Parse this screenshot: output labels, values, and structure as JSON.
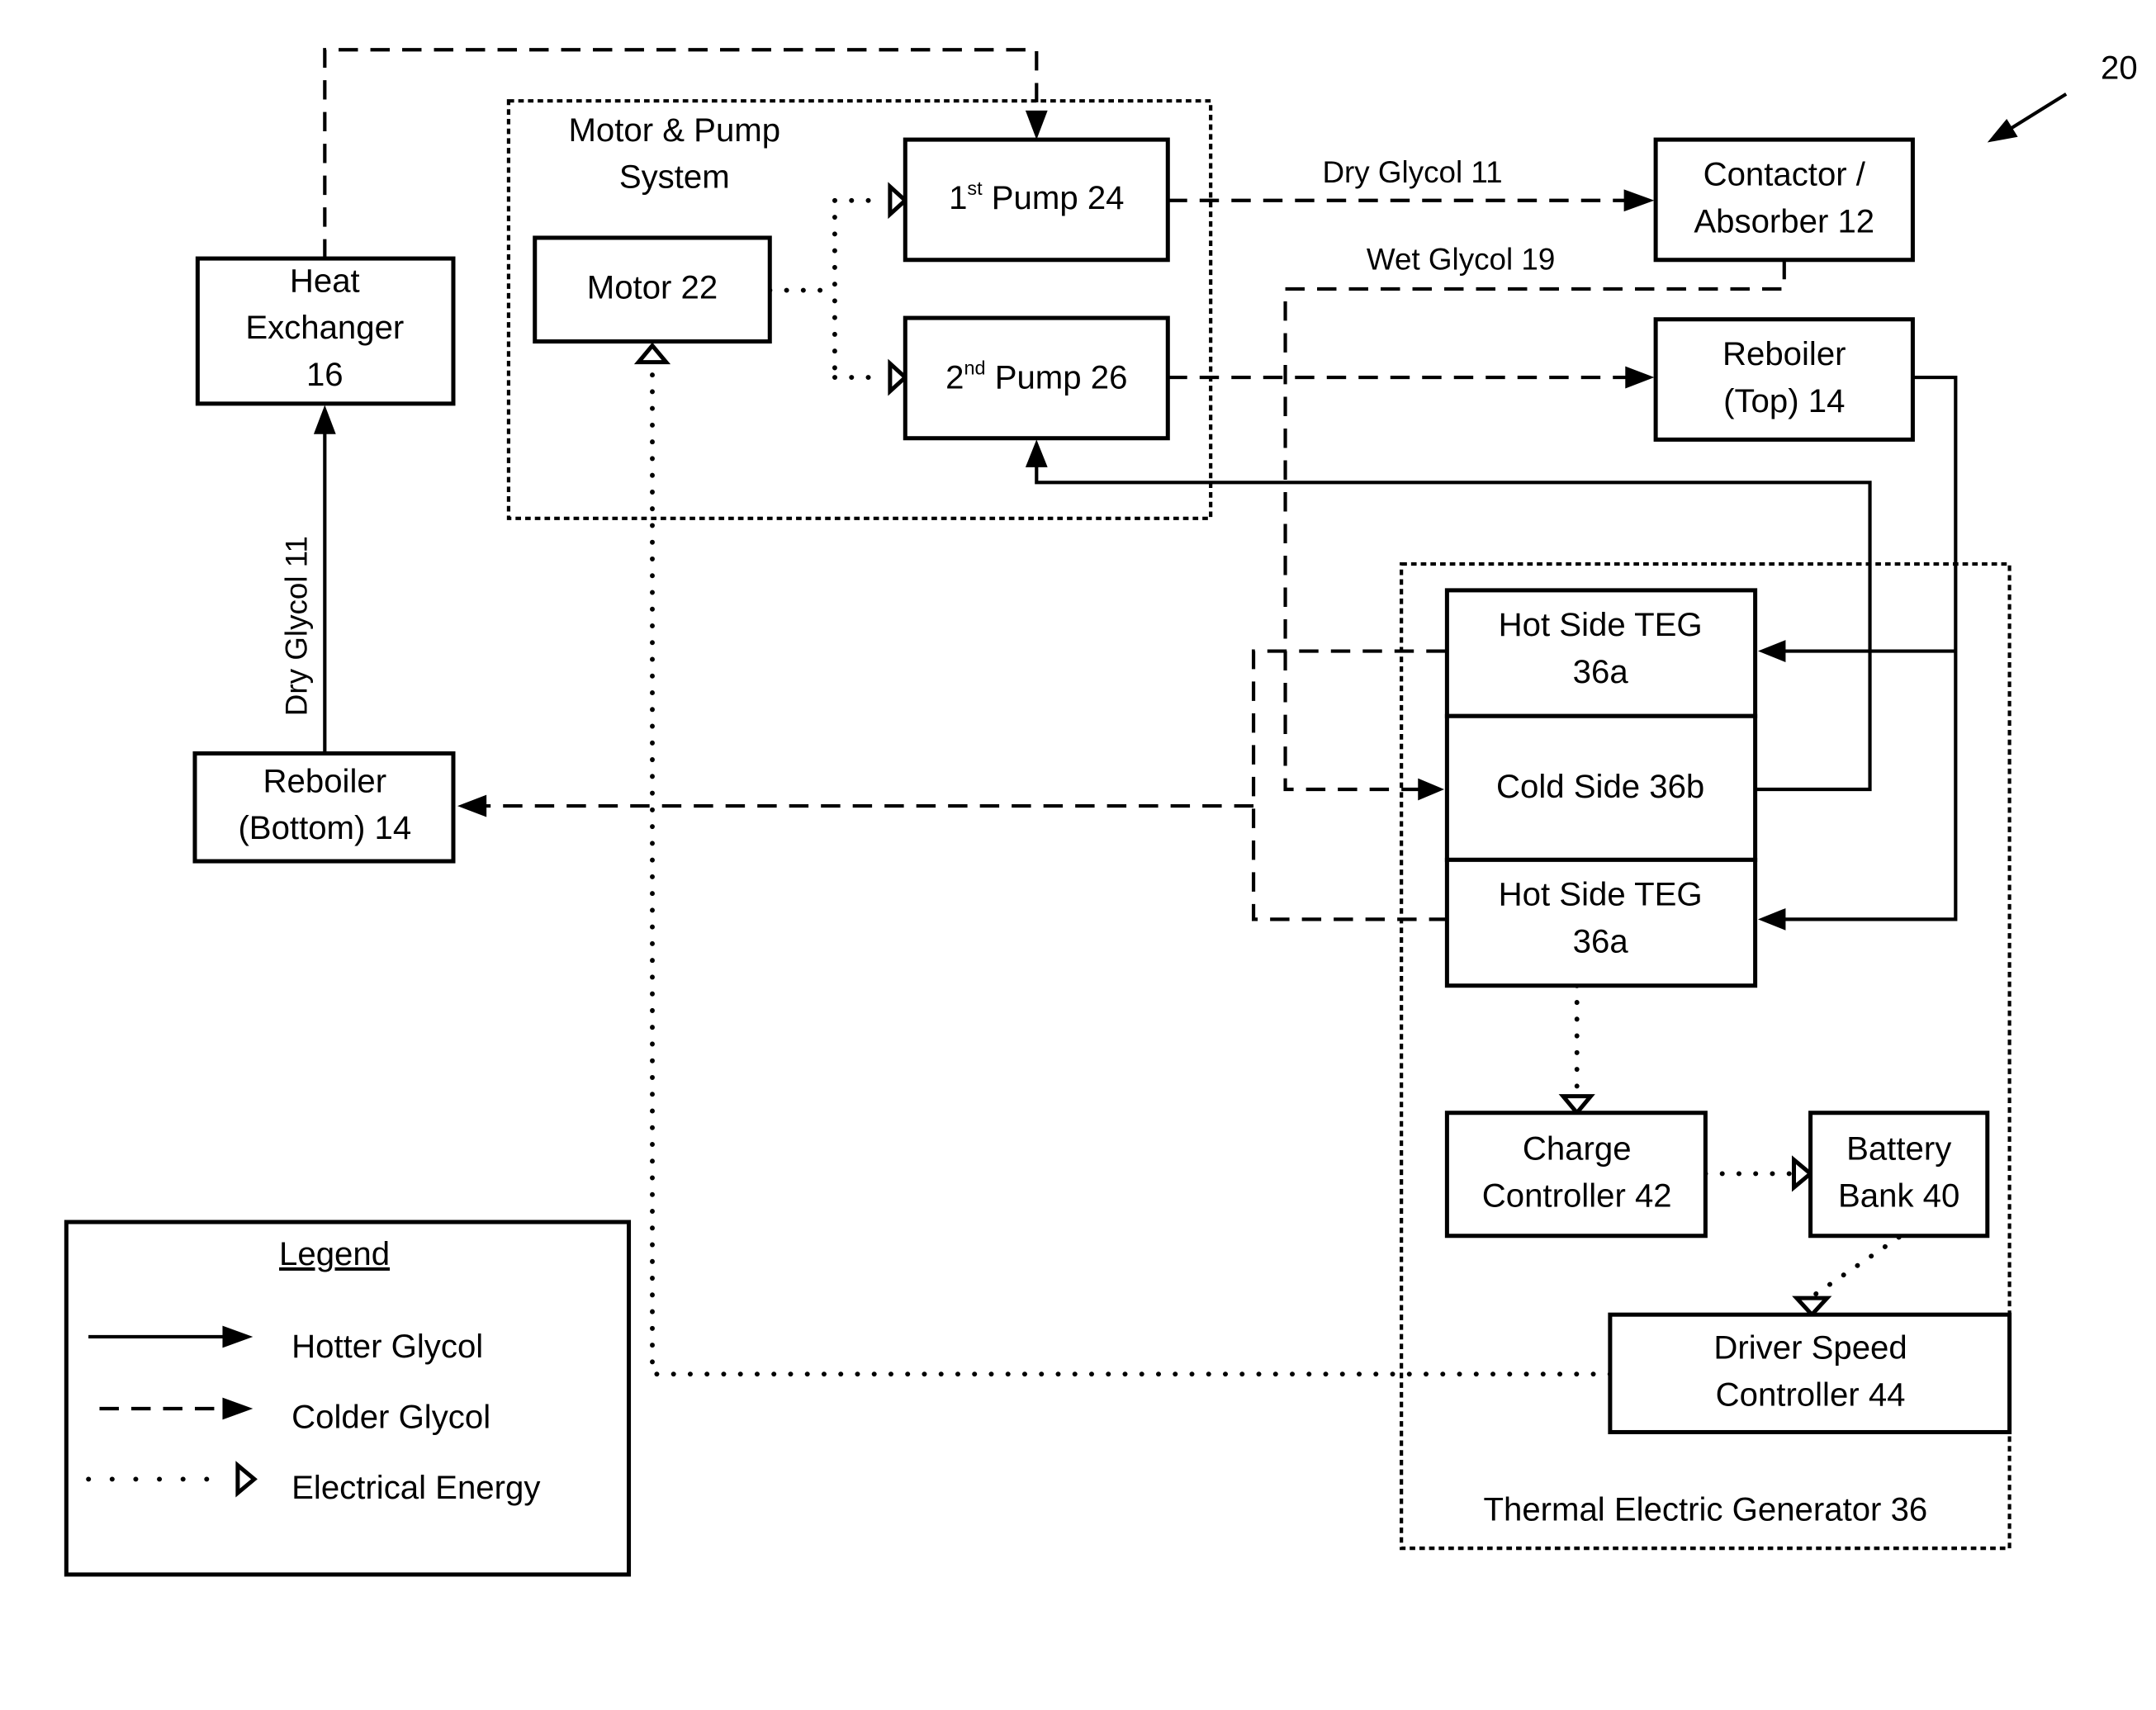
{
  "figure_ref": "20",
  "groups": {
    "motor_pump": {
      "line1": "Motor & Pump",
      "line2": "System"
    },
    "teg": {
      "label": "Thermal Electric Generator 36"
    }
  },
  "components": {
    "heat_exchanger": {
      "line1": "Heat",
      "line2": "Exchanger",
      "line3": "16"
    },
    "motor": {
      "label": "Motor 22"
    },
    "pump1": {
      "ordinal": "1",
      "sup": "st",
      "rest": " Pump 24"
    },
    "pump2": {
      "ordinal": "2",
      "sup": "nd",
      "rest": " Pump 26"
    },
    "contactor": {
      "line1": "Contactor /",
      "line2": "Absorber 12"
    },
    "reboiler_top": {
      "line1": "Reboiler",
      "line2": "(Top) 14"
    },
    "reboiler_bottom": {
      "line1": "Reboiler",
      "line2": "(Bottom) 14"
    },
    "hot_side_top": {
      "line1": "Hot Side TEG",
      "line2": "36a"
    },
    "cold_side": {
      "label": "Cold Side 36b"
    },
    "hot_side_bottom": {
      "line1": "Hot Side TEG",
      "line2": "36a"
    },
    "charge_controller": {
      "line1": "Charge",
      "line2": "Controller 42"
    },
    "battery_bank": {
      "line1": "Battery",
      "line2": "Bank 40"
    },
    "driver_speed": {
      "line1": "Driver Speed",
      "line2": "Controller 44"
    }
  },
  "flow_labels": {
    "dry_glycol_top": "Dry Glycol 11",
    "wet_glycol": "Wet Glycol 19",
    "dry_glycol_vertical": "Dry Glycol 11"
  },
  "legend": {
    "title": "Legend",
    "items": [
      {
        "style": "solid",
        "label": "Hotter Glycol"
      },
      {
        "style": "dashed",
        "label": "Colder Glycol"
      },
      {
        "style": "dotted",
        "label": "Electrical Energy"
      }
    ]
  }
}
